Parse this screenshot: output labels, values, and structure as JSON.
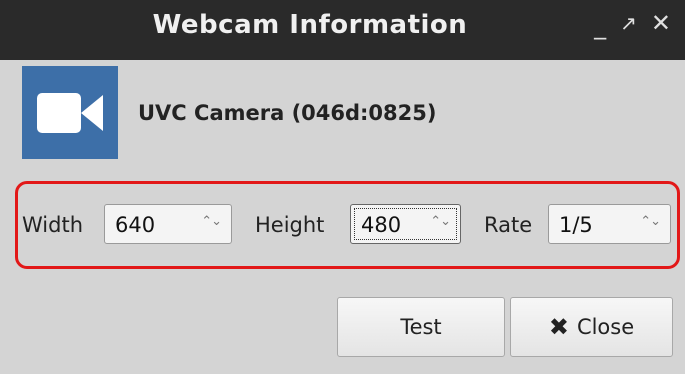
{
  "window": {
    "title": "Webcam Information",
    "controls": {
      "minimize": "_",
      "maximize": "↗",
      "close": "✕"
    }
  },
  "camera": {
    "icon": "video-camera-icon",
    "name": "UVC Camera (046d:0825)",
    "icon_color": "#3d6fa8"
  },
  "settings": {
    "highlight_color": "#e21818",
    "width": {
      "label": "Width",
      "value": "640"
    },
    "height": {
      "label": "Height",
      "value": "480"
    },
    "rate": {
      "label": "Rate",
      "value": "1/5"
    }
  },
  "buttons": {
    "test": "Test",
    "close": "Close",
    "close_icon": "✖"
  }
}
